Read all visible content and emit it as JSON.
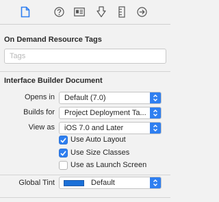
{
  "toolbar": {
    "icons": [
      "file-inspector-icon",
      "quick-help-icon",
      "identity-icon",
      "attributes-icon",
      "size-icon",
      "connections-icon"
    ],
    "active_index": 0,
    "accent_color": "#2f7ff0"
  },
  "on_demand": {
    "title": "On Demand Resource Tags",
    "tags_placeholder": "Tags",
    "tags_value": ""
  },
  "ib_document": {
    "title": "Interface Builder Document",
    "opens_in": {
      "label": "Opens in",
      "value": "Default (7.0)"
    },
    "builds_for": {
      "label": "Builds for",
      "value": "Project Deployment Ta..."
    },
    "view_as": {
      "label": "View as",
      "value": "iOS 7.0 and Later"
    },
    "use_auto_layout": {
      "label": "Use Auto Layout",
      "checked": true
    },
    "use_size_classes": {
      "label": "Use Size Classes",
      "checked": true
    },
    "use_as_launch_screen": {
      "label": "Use as Launch Screen",
      "checked": false
    }
  },
  "global_tint": {
    "label": "Global Tint",
    "value": "Default",
    "swatch_color": "#1a6fd8"
  }
}
